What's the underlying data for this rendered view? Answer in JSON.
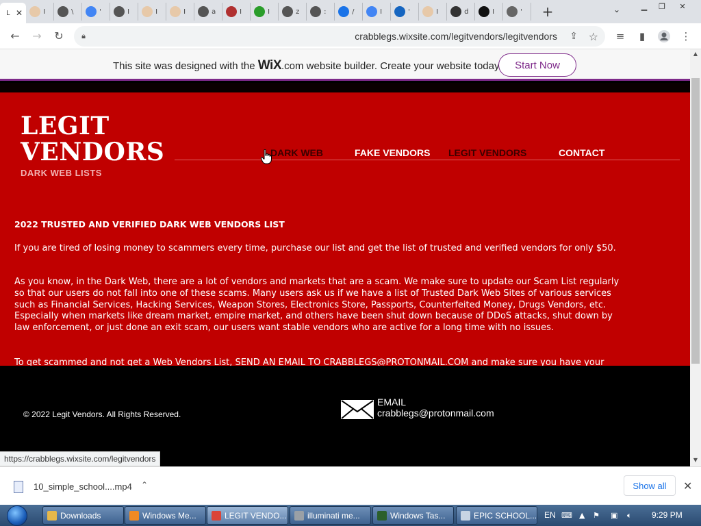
{
  "browser": {
    "tabs": [
      {
        "label": "L",
        "icon": "page-icon",
        "color": "#ffffff",
        "active": true
      },
      {
        "label": "I",
        "icon": "person-icon",
        "color": "#e7c9a9"
      },
      {
        "label": "\\",
        "icon": "globe-icon",
        "color": "#555555"
      },
      {
        "label": "'",
        "icon": "google-icon",
        "color": "#4285f4"
      },
      {
        "label": "I",
        "icon": "globe-icon",
        "color": "#555555"
      },
      {
        "label": "I",
        "icon": "person-icon",
        "color": "#e7c9a9"
      },
      {
        "label": "I",
        "icon": "person-icon",
        "color": "#e7c9a9"
      },
      {
        "label": "a",
        "icon": "globe-icon",
        "color": "#555555"
      },
      {
        "label": "I",
        "icon": "avatar-icon",
        "color": "#b03030"
      },
      {
        "label": "I",
        "icon": "check-icon",
        "color": "#2a9d2a"
      },
      {
        "label": "z",
        "icon": "globe-icon",
        "color": "#555555"
      },
      {
        "label": ":",
        "icon": "globe-icon",
        "color": "#555555"
      },
      {
        "label": "/",
        "icon": "cloud-icon",
        "color": "#1a73e8"
      },
      {
        "label": "I",
        "icon": "google-icon",
        "color": "#4285f4"
      },
      {
        "label": "'",
        "icon": "malwarebytes-icon",
        "color": "#1565c0"
      },
      {
        "label": "I",
        "icon": "person-icon",
        "color": "#e7c9a9"
      },
      {
        "label": "d",
        "icon": "speaker-icon",
        "color": "#333333"
      },
      {
        "label": "I",
        "icon": "plus-square-icon",
        "color": "#111111"
      },
      {
        "label": "'",
        "icon": "qr-icon",
        "color": "#666666"
      }
    ],
    "tab_close": "✕",
    "new_tab": "+",
    "url": "crabblegs.wixsite.com/legitvendors/legitvendors",
    "status_url": "https://crabblegs.wixsite.com/legitvendors"
  },
  "wix_banner": {
    "prefix": "This site was designed with the ",
    "brand": "WiX",
    "suffix": ".com website builder. Create your website today.",
    "cta": "Start Now"
  },
  "site": {
    "title_line1": "LEGIT",
    "title_line2": "VENDORS",
    "subtitle": "DARK WEB LISTS",
    "nav": [
      "DARK WEB",
      "FAKE VENDORS",
      "LEGIT VENDORS",
      "CONTACT"
    ],
    "heading": "2022 TRUSTED AND VERIFIED DARK WEB VENDORS LIST",
    "para1": "If you are tired of losing money to scammers every time, purchase our list and get the list of trusted and verified vendors for only $50.",
    "para2": "As you know, in the Dark Web, there are a lot of vendors and markets that are a scam. We make sure to update our Scam List regularly so that our users do not fall into one of these scams. Many users ask us if we have a list of Trusted Dark Web Sites of various services such as Financial Services, Hacking Services, Weapon Stores, Electronics Store, Passports, Counterfeited Money, Drugs Vendors, etc. Especially when markets like dream market, empire market, and others have been shut down because of DDoS attacks, shut down by law enforcement, or just done an exit scam, our users want stable vendors who are active for a long time with no issues.",
    "para3": "To get scammed and not get a Web Vendors List, SEND AN EMAIL TO CRABBLEGS@PROTONMAIL.COM and make sure you have your",
    "copyright": "© 2022 Legit Vendors. All Rights Reserved.",
    "email_label": "EMAIL",
    "email_value": "crabblegs@protonmail.com",
    "colors": {
      "red": "#c00000",
      "accent": "#7e2a8a"
    }
  },
  "download": {
    "filename": "10_simple_school....mp4",
    "show_all": "Show all"
  },
  "taskbar": {
    "tasks": [
      {
        "label": "Downloads",
        "color": "#e6b84a"
      },
      {
        "label": "Windows Me...",
        "color": "#f08a24"
      },
      {
        "label": "LEGIT VENDO...",
        "color": "#db4437",
        "active": true
      },
      {
        "label": "illuminati me...",
        "color": "#9aa0a6"
      },
      {
        "label": "Windows Tas...",
        "color": "#2b5f2b"
      },
      {
        "label": "EPIC SCHOOL...",
        "color": "#c8d4e3"
      }
    ],
    "lang": "EN",
    "clock": "9:29 PM"
  }
}
